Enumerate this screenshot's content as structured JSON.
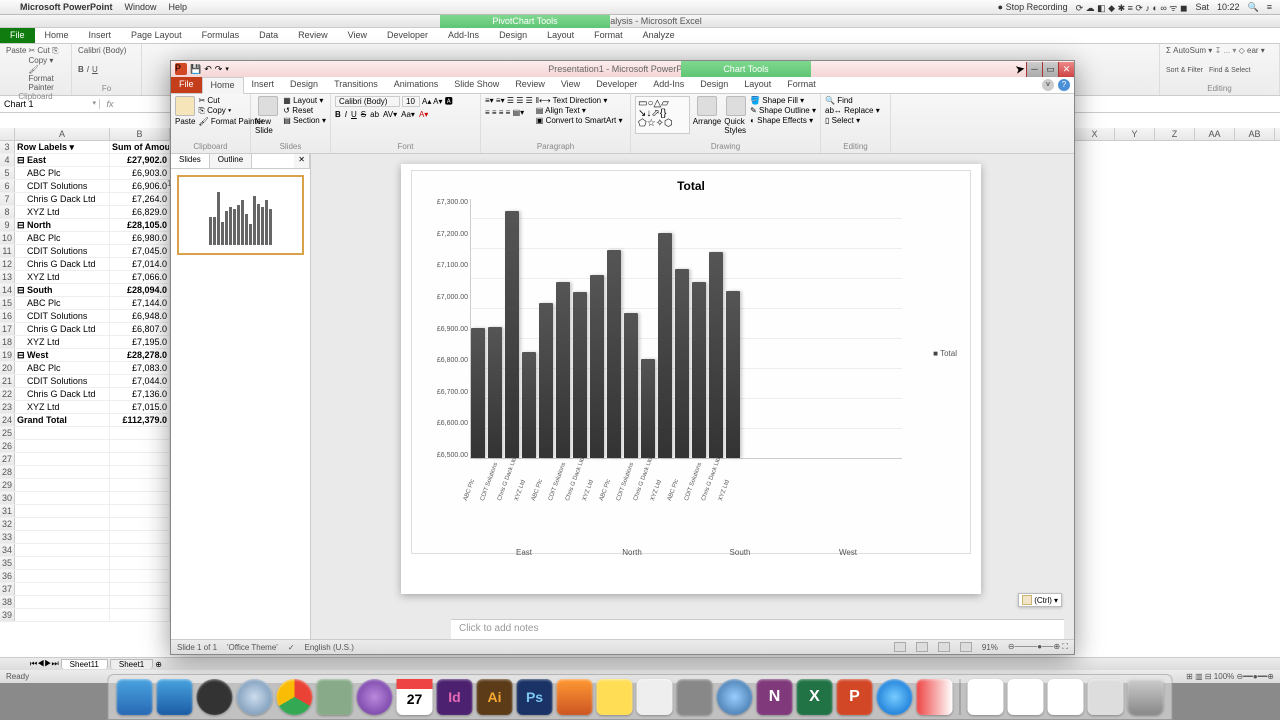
{
  "mac_menu": {
    "app": "Microsoft PowerPoint",
    "items": [
      "Window",
      "Help"
    ],
    "right": {
      "stop_rec": "Stop Recording",
      "day": "Sat",
      "time": "10:22"
    }
  },
  "excel": {
    "title": "Data Analysis - Microsoft Excel",
    "pivot_tools": "PivotChart Tools",
    "tabs": [
      "File",
      "Home",
      "Insert",
      "Page Layout",
      "Formulas",
      "Data",
      "Review",
      "View",
      "Developer",
      "Add-Ins",
      "Design",
      "Layout",
      "Format",
      "Analyze"
    ],
    "ribbon": {
      "clipboard": {
        "paste": "Paste",
        "cut": "Cut",
        "copy": "Copy",
        "fp": "Format Painter",
        "lbl": "Clipboard"
      },
      "font": {
        "name": "Calibri (Body)",
        "lbl": "Fo"
      },
      "editing": {
        "autosum": "AutoSum",
        "sort": "Sort & Filter",
        "find": "Find & Select",
        "clear": "ear",
        "lbl": "Editing"
      }
    },
    "name_box": "Chart 1",
    "columns": [
      {
        "l": "A",
        "w": 95
      },
      {
        "l": "B",
        "w": 60
      }
    ],
    "right_columns": [
      "X",
      "Y",
      "Z",
      "AA",
      "AB"
    ],
    "rows": [
      {
        "n": 3,
        "a": "Row Labels",
        "b": "Sum of Amoun",
        "bold": true,
        "dd": true
      },
      {
        "n": 4,
        "a": "East",
        "b": "£27,902.0",
        "bold": true,
        "exp": true
      },
      {
        "n": 5,
        "a": "ABC Plc",
        "b": "£6,903.0",
        "indent": true
      },
      {
        "n": 6,
        "a": "CDIT Solutions",
        "b": "£6,906.0",
        "indent": true
      },
      {
        "n": 7,
        "a": "Chris G Dack Ltd",
        "b": "£7,264.0",
        "indent": true
      },
      {
        "n": 8,
        "a": "XYZ Ltd",
        "b": "£6,829.0",
        "indent": true
      },
      {
        "n": 9,
        "a": "North",
        "b": "£28,105.0",
        "bold": true,
        "exp": true
      },
      {
        "n": 10,
        "a": "ABC Plc",
        "b": "£6,980.0",
        "indent": true
      },
      {
        "n": 11,
        "a": "CDIT Solutions",
        "b": "£7,045.0",
        "indent": true
      },
      {
        "n": 12,
        "a": "Chris G Dack Ltd",
        "b": "£7,014.0",
        "indent": true
      },
      {
        "n": 13,
        "a": "XYZ Ltd",
        "b": "£7,066.0",
        "indent": true
      },
      {
        "n": 14,
        "a": "South",
        "b": "£28,094.0",
        "bold": true,
        "exp": true
      },
      {
        "n": 15,
        "a": "ABC Plc",
        "b": "£7,144.0",
        "indent": true
      },
      {
        "n": 16,
        "a": "CDIT Solutions",
        "b": "£6,948.0",
        "indent": true
      },
      {
        "n": 17,
        "a": "Chris G Dack Ltd",
        "b": "£6,807.0",
        "indent": true
      },
      {
        "n": 18,
        "a": "XYZ Ltd",
        "b": "£7,195.0",
        "indent": true
      },
      {
        "n": 19,
        "a": "West",
        "b": "£28,278.0",
        "bold": true,
        "exp": true
      },
      {
        "n": 20,
        "a": "ABC Plc",
        "b": "£7,083.0",
        "indent": true
      },
      {
        "n": 21,
        "a": "CDIT Solutions",
        "b": "£7,044.0",
        "indent": true
      },
      {
        "n": 22,
        "a": "Chris G Dack Ltd",
        "b": "£7,136.0",
        "indent": true
      },
      {
        "n": 23,
        "a": "XYZ Ltd",
        "b": "£7,015.0",
        "indent": true
      },
      {
        "n": 24,
        "a": "Grand Total",
        "b": "£112,379.0",
        "bold": true
      }
    ],
    "empty_rows": [
      25,
      26,
      27,
      28,
      29,
      30,
      31,
      32,
      33,
      34,
      35,
      36,
      37,
      38,
      39
    ],
    "sheet_tabs": [
      "Sheet11",
      "Sheet1"
    ],
    "status": {
      "left": "Ready",
      "zoom": "100%"
    }
  },
  "pp": {
    "title": "Presentation1 - Microsoft PowerPoint",
    "chart_tools": "Chart Tools",
    "tabs": [
      "File",
      "Home",
      "Insert",
      "Design",
      "Transitions",
      "Animations",
      "Slide Show",
      "Review",
      "View",
      "Developer",
      "Add-Ins",
      "Design",
      "Layout",
      "Format"
    ],
    "ribbon": {
      "clipboard": {
        "paste": "Paste",
        "cut": "Cut",
        "copy": "Copy",
        "fp": "Format Painter",
        "lbl": "Clipboard"
      },
      "slides": {
        "new": "New Slide",
        "layout": "Layout",
        "reset": "Reset",
        "section": "Section",
        "lbl": "Slides"
      },
      "font": {
        "name": "Calibri (Body)",
        "size": "10",
        "lbl": "Font"
      },
      "paragraph": {
        "td": "Text Direction",
        "at": "Align Text",
        "cs": "Convert to SmartArt",
        "lbl": "Paragraph"
      },
      "drawing": {
        "arrange": "Arrange",
        "qs": "Quick Styles",
        "sf": "Shape Fill",
        "so": "Shape Outline",
        "se": "Shape Effects",
        "lbl": "Drawing"
      },
      "editing": {
        "find": "Find",
        "replace": "Replace",
        "select": "Select",
        "lbl": "Editing"
      }
    },
    "thumbs_tabs": {
      "slides": "Slides",
      "outline": "Outline"
    },
    "notes_placeholder": "Click to add notes",
    "status": {
      "slide": "Slide 1 of 1",
      "theme": "'Office Theme'",
      "lang": "English (U.S.)",
      "zoom": "91%"
    },
    "paste_opts": "(Ctrl)"
  },
  "chart_data": {
    "type": "bar",
    "title": "Total",
    "ylabel": "",
    "ylim": [
      6500,
      7300
    ],
    "yticks": [
      "£7,300.00",
      "£7,200.00",
      "£7,100.00",
      "£7,000.00",
      "£6,900.00",
      "£6,800.00",
      "£6,700.00",
      "£6,600.00",
      "£6,500.00"
    ],
    "legend": "Total",
    "regions": [
      "East",
      "North",
      "South",
      "West"
    ],
    "categories": [
      "ABC Plc",
      "CDIT Solutions",
      "Chris G Dack Ltd",
      "XYZ Ltd",
      "ABC Plc",
      "CDIT Solutions",
      "Chris G Dack Ltd",
      "XYZ Ltd",
      "ABC Plc",
      "CDIT Solutions",
      "Chris G Dack Ltd",
      "XYZ Ltd",
      "ABC Plc",
      "CDIT Solutions",
      "Chris G Dack Ltd",
      "XYZ Ltd"
    ],
    "values": [
      6903,
      6906,
      7264,
      6829,
      6980,
      7045,
      7014,
      7066,
      7144,
      6948,
      6807,
      7195,
      7083,
      7044,
      7136,
      7015
    ]
  }
}
